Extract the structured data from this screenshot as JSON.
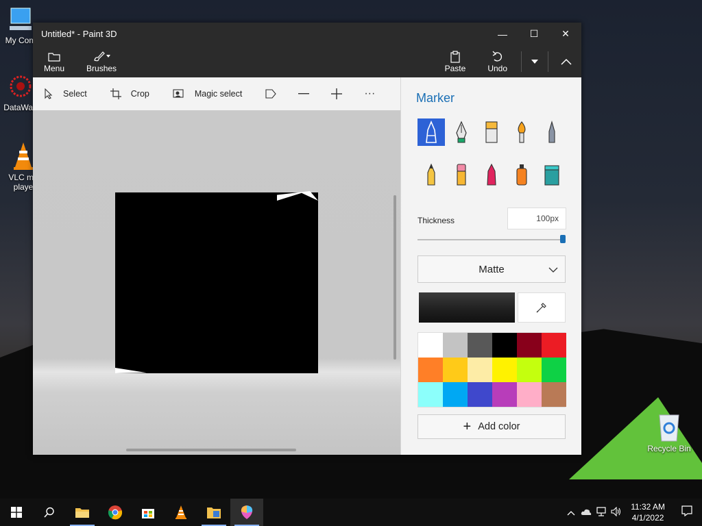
{
  "desktop": {
    "icons": [
      {
        "label": "My Com",
        "icon": "computer-icon"
      },
      {
        "label": "DataWag",
        "icon": "datawagon-icon"
      },
      {
        "label": "VLC me\nplaye",
        "icon": "vlc-icon"
      },
      {
        "label": "Recycle Bin",
        "icon": "recycle-bin-icon"
      }
    ]
  },
  "window": {
    "title": "Untitled* - Paint 3D",
    "minimize": "—",
    "maximize": "☐",
    "close": "✕"
  },
  "ribbon": {
    "menu": "Menu",
    "brushes": "Brushes",
    "paste": "Paste",
    "undo": "Undo"
  },
  "toolbar": {
    "select": "Select",
    "crop": "Crop",
    "magic_select": "Magic select",
    "more": "···"
  },
  "panel": {
    "title": "Marker",
    "brushes": [
      {
        "name": "marker",
        "selected": true
      },
      {
        "name": "calligraphy-pen"
      },
      {
        "name": "oil-brush"
      },
      {
        "name": "watercolor"
      },
      {
        "name": "pixel-pen"
      },
      {
        "name": "pencil"
      },
      {
        "name": "eraser"
      },
      {
        "name": "crayon"
      },
      {
        "name": "spray-can"
      },
      {
        "name": "fill"
      }
    ],
    "thickness_label": "Thickness",
    "thickness_value": "100px",
    "thickness_fraction": 1.0,
    "finish": "Matte",
    "current_color": "#1e1e1e",
    "palette": [
      "#ffffff",
      "#c3c3c3",
      "#585858",
      "#000000",
      "#88001b",
      "#ec1c24",
      "#ff7f27",
      "#ffca18",
      "#fdeca6",
      "#fff200",
      "#c4ff0e",
      "#0ed145",
      "#8cfffb",
      "#00a8f3",
      "#3f48cc",
      "#b83dba",
      "#ffaec8",
      "#b97a56"
    ],
    "add_color": "Add color"
  },
  "taskbar": {
    "clock_time": "11:32 AM",
    "clock_date": "4/1/2022"
  }
}
